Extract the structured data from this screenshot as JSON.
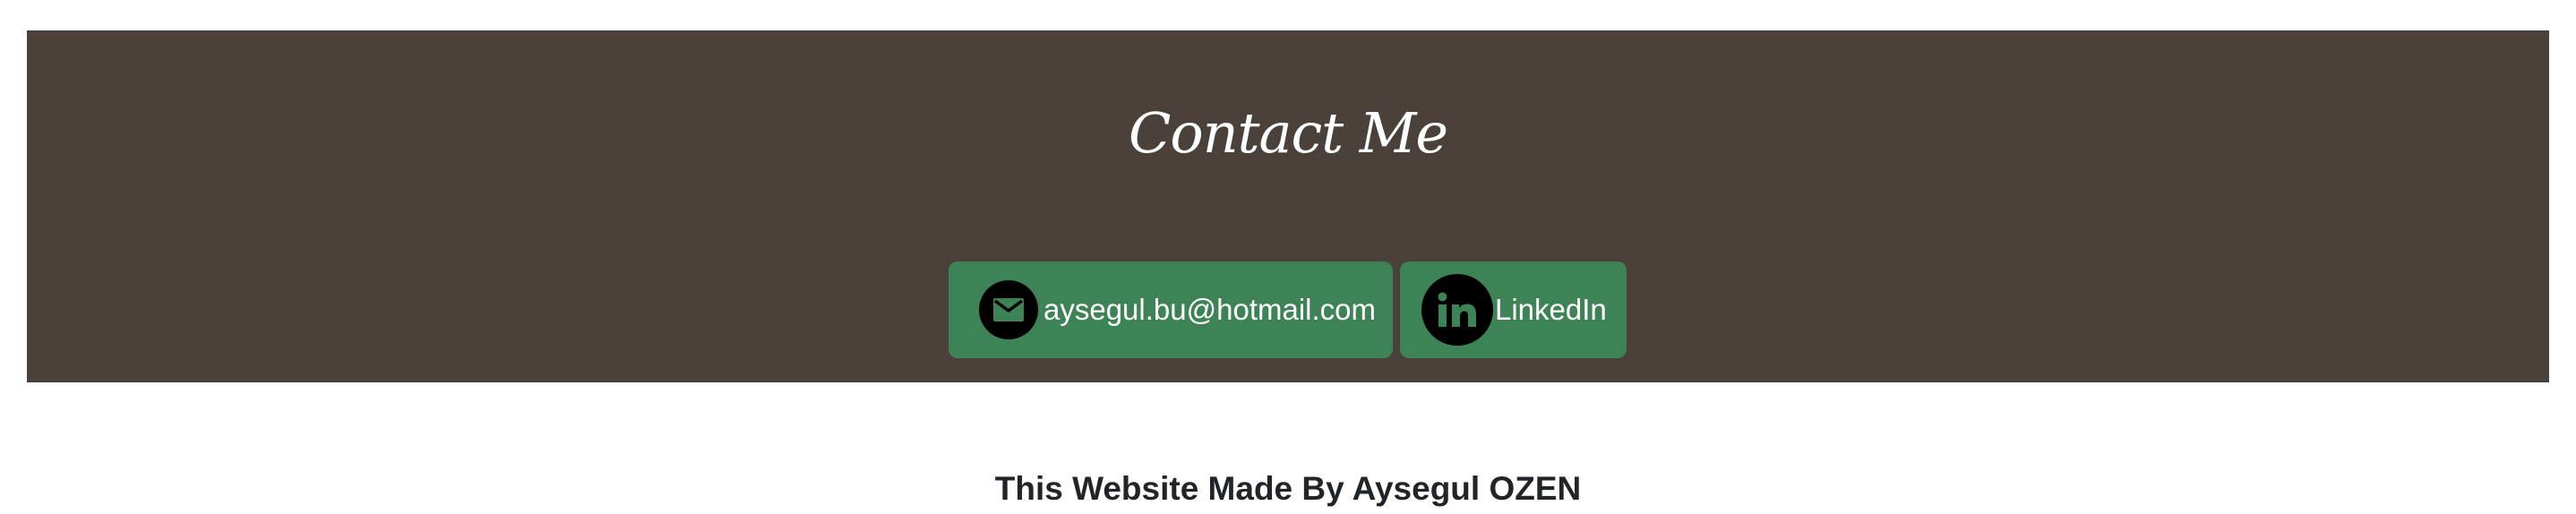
{
  "contact": {
    "title": "Contact Me",
    "background_color": "#4a413b",
    "button_color": "#3e8356",
    "email": {
      "label": "aysegul.bu@hotmail.com",
      "icon": "mail-icon"
    },
    "linkedin": {
      "label": "LinkedIn",
      "icon": "linkedin-icon"
    }
  },
  "footer": {
    "text": "This Website Made By Aysegul OZEN"
  }
}
